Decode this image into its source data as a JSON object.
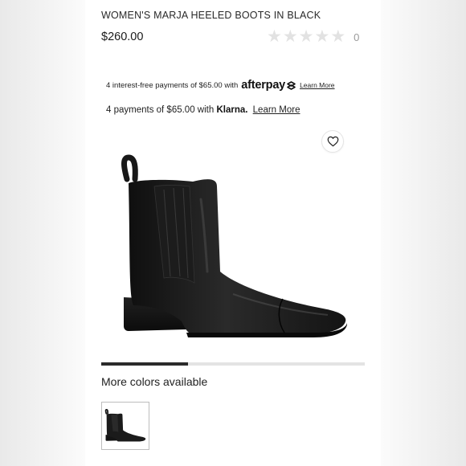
{
  "product": {
    "title": "WOMEN'S MARJA HEELED BOOTS IN BLACK",
    "price": "$260.00",
    "rating": {
      "stars_filled": 0,
      "stars_total": 5,
      "review_count": "0"
    }
  },
  "payments": {
    "afterpay": {
      "text": "4 interest-free payments of $65.00 with",
      "brand": "afterpay",
      "link": "Learn More"
    },
    "klarna": {
      "text_before": "4 payments of $65.00 with",
      "brand": "Klarna.",
      "link": "Learn More"
    }
  },
  "gallery": {
    "wishlist_icon": "heart-outline-icon",
    "image": "black-leather-chelsea-boot",
    "progress": 0.33
  },
  "colors": {
    "heading": "More colors available",
    "swatches": [
      {
        "image": "black-leather-chelsea-boot",
        "selected": true
      }
    ]
  },
  "theme": {
    "text": "#222222",
    "track": "#e3e3e3",
    "fill": "#2b2b2b",
    "star_empty": "#e2e2e2"
  }
}
